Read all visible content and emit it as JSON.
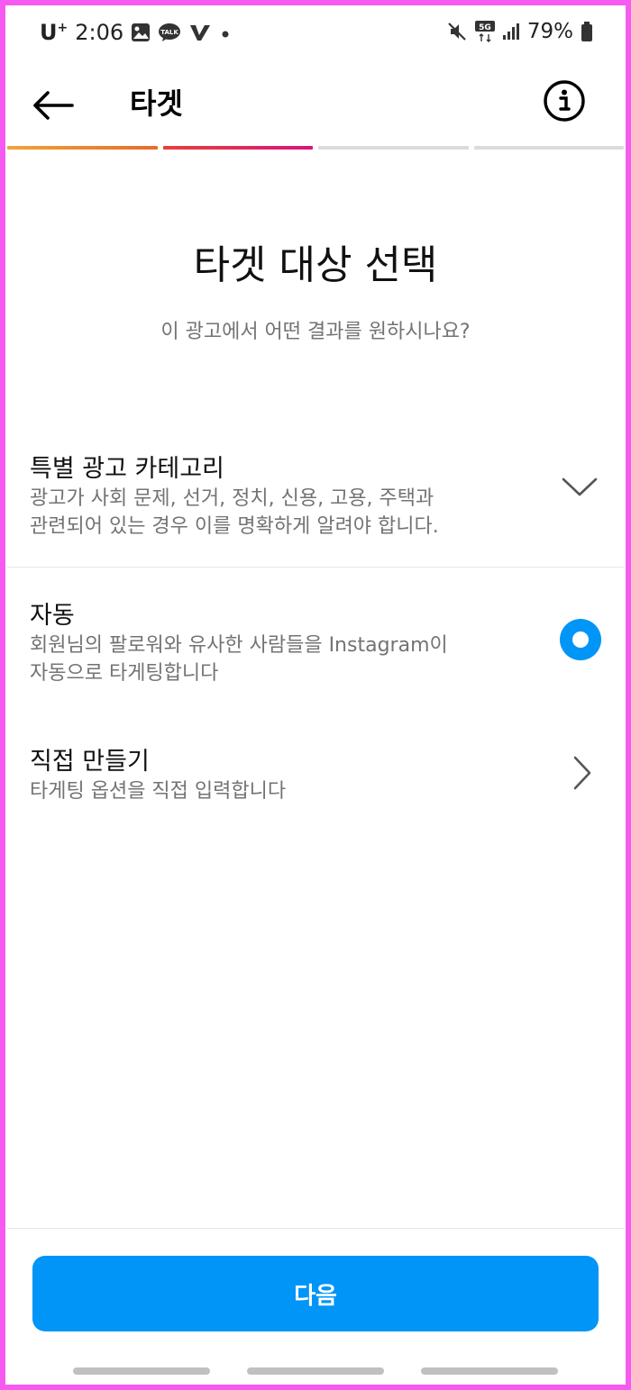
{
  "status_bar": {
    "carrier": "U",
    "carrier_sup": "+",
    "time": "2:06",
    "notification_icons": [
      "gallery-icon",
      "kakaotalk-icon",
      "v-app-icon",
      "dot-icon"
    ],
    "talk_badge": "TALK",
    "network": "5G",
    "battery": "79%"
  },
  "header": {
    "title": "타겟"
  },
  "progress": {
    "steps_total": 4,
    "segments": [
      {
        "color": "#f0a43b",
        "color_end": "#e86b2a"
      },
      {
        "color": "#e8403a",
        "color_end": "#d4177d"
      },
      {
        "color": "#dbdbdb",
        "color_end": "#dbdbdb"
      },
      {
        "color": "#dbdbdb",
        "color_end": "#dbdbdb"
      }
    ]
  },
  "main": {
    "title": "타겟 대상 선택",
    "subtitle": "이 광고에서 어떤 결과를 원하시나요?"
  },
  "options": {
    "special": {
      "title": "특별 광고 카테고리",
      "desc_line1": "광고가 사회 문제, 선거, 정치, 신용, 고용, 주택과",
      "desc_line2": "관련되어 있는 경우 이를 명확하게 알려야 합니다."
    },
    "auto": {
      "title": "자동",
      "desc_line1": "회원님의 팔로워와 유사한 사람들을 Instagram이",
      "desc_line2": "자동으로 타게팅합니다",
      "selected": true
    },
    "manual": {
      "title": "직접 만들기",
      "desc_line1": "타게팅 옵션을 직접 입력합니다"
    }
  },
  "footer": {
    "next_label": "다음"
  },
  "colors": {
    "accent": "#0095f6",
    "frame": "#f55bf0",
    "secondary_text": "#737373"
  }
}
